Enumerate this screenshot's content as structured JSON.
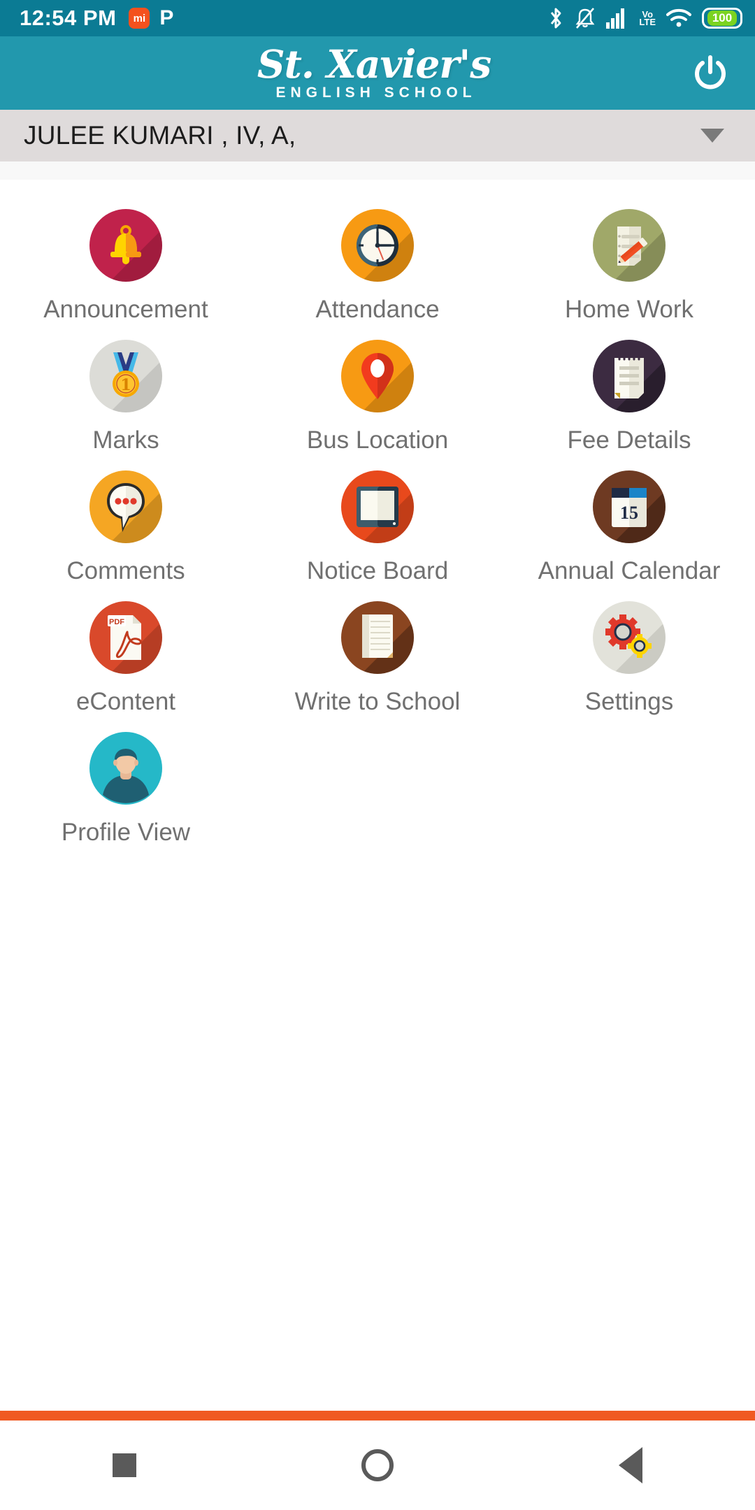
{
  "status_bar": {
    "time": "12:54 PM",
    "left_icons": [
      "mi-icon",
      "phonepe-icon"
    ],
    "mi_label": "mi",
    "phonepe_label": "P",
    "right_icons": [
      "bluetooth-icon",
      "silent-bell-icon",
      "signal-bars-icon",
      "volte-icon",
      "wifi-icon",
      "battery-icon"
    ],
    "volte_top": "Vo",
    "volte_bottom": "LTE",
    "battery_level": "100",
    "background_color": "#0b7b94",
    "battery_color": "#7BD321"
  },
  "header": {
    "school_name": "St. Xavier's",
    "school_subtitle": "ENGLISH SCHOOL",
    "power_icon": "power-icon",
    "background_color": "#2298AD"
  },
  "selector": {
    "student": "JULEE  KUMARI , IV, A,",
    "caret_icon": "chevron-down-icon",
    "background_color": "#DFDBDB"
  },
  "grid": {
    "items": [
      {
        "label": "Announcement",
        "icon": "bell-icon",
        "circle_color": "#C0224B"
      },
      {
        "label": "Attendance",
        "icon": "clock-icon",
        "circle_color": "#F79A13"
      },
      {
        "label": "Home Work",
        "icon": "homework-icon",
        "circle_color": "#A0A869"
      },
      {
        "label": "Marks",
        "icon": "medal-icon",
        "circle_color": "#DCDCD7"
      },
      {
        "label": "Bus Location",
        "icon": "map-pin-icon",
        "circle_color": "#F79A13"
      },
      {
        "label": "Fee Details",
        "icon": "notepad-icon",
        "circle_color": "#3C2B41"
      },
      {
        "label": "Comments",
        "icon": "comment-icon",
        "circle_color": "#F5A623"
      },
      {
        "label": "Notice Board",
        "icon": "tablet-icon",
        "circle_color": "#E8491C"
      },
      {
        "label": "Annual Calendar",
        "icon": "calendar-icon",
        "circle_color": "#6E3A22",
        "calendar_day": "15"
      },
      {
        "label": "eContent",
        "icon": "pdf-icon",
        "circle_color": "#D9492B",
        "pdf_label": "PDF"
      },
      {
        "label": "Write to School",
        "icon": "notebook-icon",
        "circle_color": "#8A4520"
      },
      {
        "label": "Settings",
        "icon": "gears-icon",
        "circle_color": "#E2E2DA"
      },
      {
        "label": "Profile View",
        "icon": "avatar-icon",
        "circle_color": "#25B8C8"
      }
    ]
  },
  "bottom": {
    "accent_color": "#F05A22",
    "nav_items": [
      "recents-button",
      "home-button",
      "back-button"
    ]
  }
}
